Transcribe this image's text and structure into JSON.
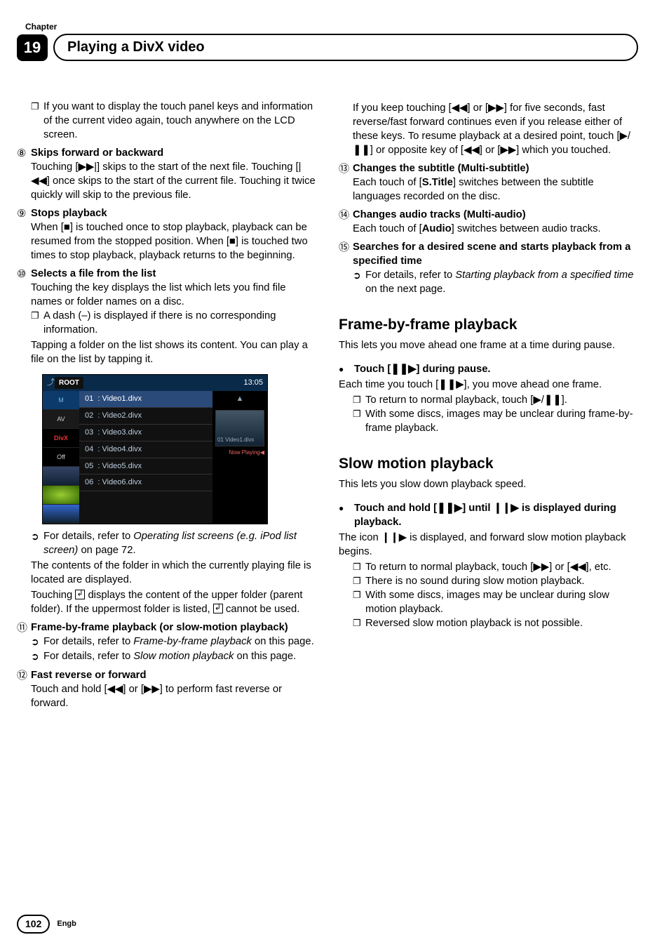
{
  "header": {
    "chapter_label": "Chapter",
    "chapter_num": "19",
    "title": "Playing a DivX video"
  },
  "glyphs": {
    "skip_next": "▶▶|",
    "skip_prev": "|◀◀",
    "stop": "■",
    "rew": "◀◀",
    "fwd": "▶▶",
    "play_pause": "▶/❚❚",
    "frame": "❚❚▶",
    "slow": "❚❚▶",
    "slow_icon": "❙❙▶"
  },
  "shot": {
    "root": "ROOT",
    "time": "13:05",
    "side": {
      "divx": "DivX",
      "off": "Off"
    },
    "thumb": {
      "label": "01\nVideo1.divx",
      "now": "Now Playing◀"
    },
    "rows": [
      {
        "n": "01",
        "t": ": Video1.divx"
      },
      {
        "n": "02",
        "t": ": Video2.divx"
      },
      {
        "n": "03",
        "t": ": Video3.divx"
      },
      {
        "n": "04",
        "t": ": Video4.divx"
      },
      {
        "n": "05",
        "t": ": Video5.divx"
      },
      {
        "n": "06",
        "t": ": Video6.divx"
      }
    ]
  },
  "left": {
    "intro_box": "If you want to display the touch panel keys and information of the current video again, touch anywhere on the LCD screen.",
    "i8": {
      "t": "Skips forward or backward",
      "b": "Touching [▶▶|] skips to the start of the next file. Touching [|◀◀] once skips to the start of the current file. Touching it twice quickly will skip to the previous file."
    },
    "i9": {
      "t": "Stops playback",
      "b": "When [■] is touched once to stop playback, playback can be resumed from the stopped position. When [■] is touched two times to stop playback, playback returns to the beginning."
    },
    "i10": {
      "t": "Selects a file from the list",
      "b1": "Touching the key displays the list which lets you find file names or folder names on a disc.",
      "box": "A dash (–) is displayed if there is no corresponding information.",
      "b2": "Tapping a folder on the list shows its content. You can play a file on the list by tapping it."
    },
    "after_shot": {
      "arrow": "For details, refer to ",
      "arrow_i": "Operating list screens (e.g. iPod list screen)",
      "arrow_tail": " on page 72.",
      "p1": "The contents of the folder in which the currently playing file is located are displayed.",
      "p2a": "Touching ",
      "p2b": " displays the content of the upper folder (parent folder). If the uppermost folder is listed, ",
      "p2c": " cannot be used."
    },
    "i11": {
      "t": "Frame-by-frame playback (or slow-motion playback)",
      "a1_pre": "For details, refer to ",
      "a1_i": "Frame-by-frame playback",
      "a1_tail": " on this page.",
      "a2_pre": "For details, refer to ",
      "a2_i": "Slow motion playback",
      "a2_tail": " on this page."
    },
    "i12": {
      "t": "Fast reverse or forward",
      "b": "Touch and hold [◀◀] or [▶▶] to perform fast reverse or forward."
    }
  },
  "right": {
    "cont12": "If you keep touching [◀◀] or [▶▶] for five seconds, fast reverse/fast forward continues even if you release either of these keys. To resume playback at a desired point, touch [▶/❚❚] or opposite key of [◀◀] or [▶▶] which you touched.",
    "i13": {
      "t": "Changes the subtitle (Multi-subtitle)",
      "b": "Each touch of [S.Title] switches between the subtitle languages recorded on the disc."
    },
    "i14": {
      "t": "Changes audio tracks (Multi-audio)",
      "b": "Each touch of [Audio] switches between audio tracks."
    },
    "i15": {
      "t": "Searches for a desired scene and starts playback from a specified time",
      "a_pre": "For details, refer to ",
      "a_i": "Starting playback from a specified time",
      "a_tail": " on the next page."
    },
    "fbf": {
      "h": "Frame-by-frame playback",
      "lead": "This lets you move ahead one frame at a time during pause.",
      "step": "Touch [❚❚▶] during pause.",
      "p": "Each time you touch [❚❚▶], you move ahead one frame.",
      "b1": "To return to normal playback, touch [▶/❚❚].",
      "b2": "With some discs, images may be unclear during frame-by-frame playback."
    },
    "slow": {
      "h": "Slow motion playback",
      "lead": "This lets you slow down playback speed.",
      "step": "Touch and hold [❚❚▶] until ❙❙▶ is displayed during playback.",
      "p": "The icon ❙❙▶ is displayed, and forward slow motion playback begins.",
      "b1": "To return to normal playback, touch [▶▶] or [◀◀], etc.",
      "b2": "There is no sound during slow motion playback.",
      "b3": "With some discs, images may be unclear during slow motion playback.",
      "b4": "Reversed slow motion playback is not possible."
    }
  },
  "footer": {
    "page": "102",
    "lang": "Engb"
  }
}
